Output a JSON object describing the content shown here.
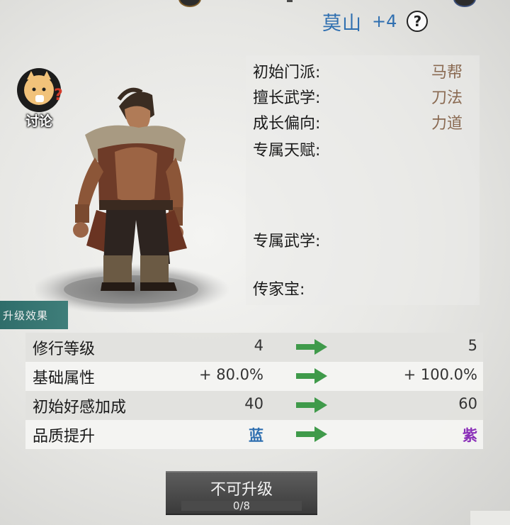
{
  "hero": {
    "name": "莫山",
    "plus": "+4",
    "help": "?"
  },
  "discuss": {
    "label": "讨论",
    "mark": "?"
  },
  "info": {
    "rows": [
      {
        "label": "初始门派:",
        "value": "马帮"
      },
      {
        "label": "擅长武学:",
        "value": "刀法"
      },
      {
        "label": "成长偏向:",
        "value": "力道"
      },
      {
        "label": "专属天赋:",
        "value": ""
      },
      {
        "label": "专属武学:",
        "value": ""
      },
      {
        "label": "传家宝:",
        "value": ""
      }
    ]
  },
  "section": {
    "title": "升级效果"
  },
  "upgrade": {
    "rows": [
      {
        "name": "修行等级",
        "from": "4",
        "to": "5"
      },
      {
        "name": "基础属性",
        "from": "+ 80.0%",
        "to": "+ 100.0%"
      },
      {
        "name": "初始好感加成",
        "from": "40",
        "to": "60"
      },
      {
        "name": "品质提升",
        "from": "蓝",
        "to": "紫"
      }
    ]
  },
  "button": {
    "label": "不可升级",
    "count": "0/8"
  },
  "colors": {
    "blue": "#2f6fb0",
    "purple": "#8a2fb8",
    "arrow": "#3f9a4a",
    "teal": "#3f7e7a"
  },
  "icons": [
    "help-icon",
    "discuss-avatar-icon",
    "arrow-right-icon",
    "character-portrait"
  ]
}
